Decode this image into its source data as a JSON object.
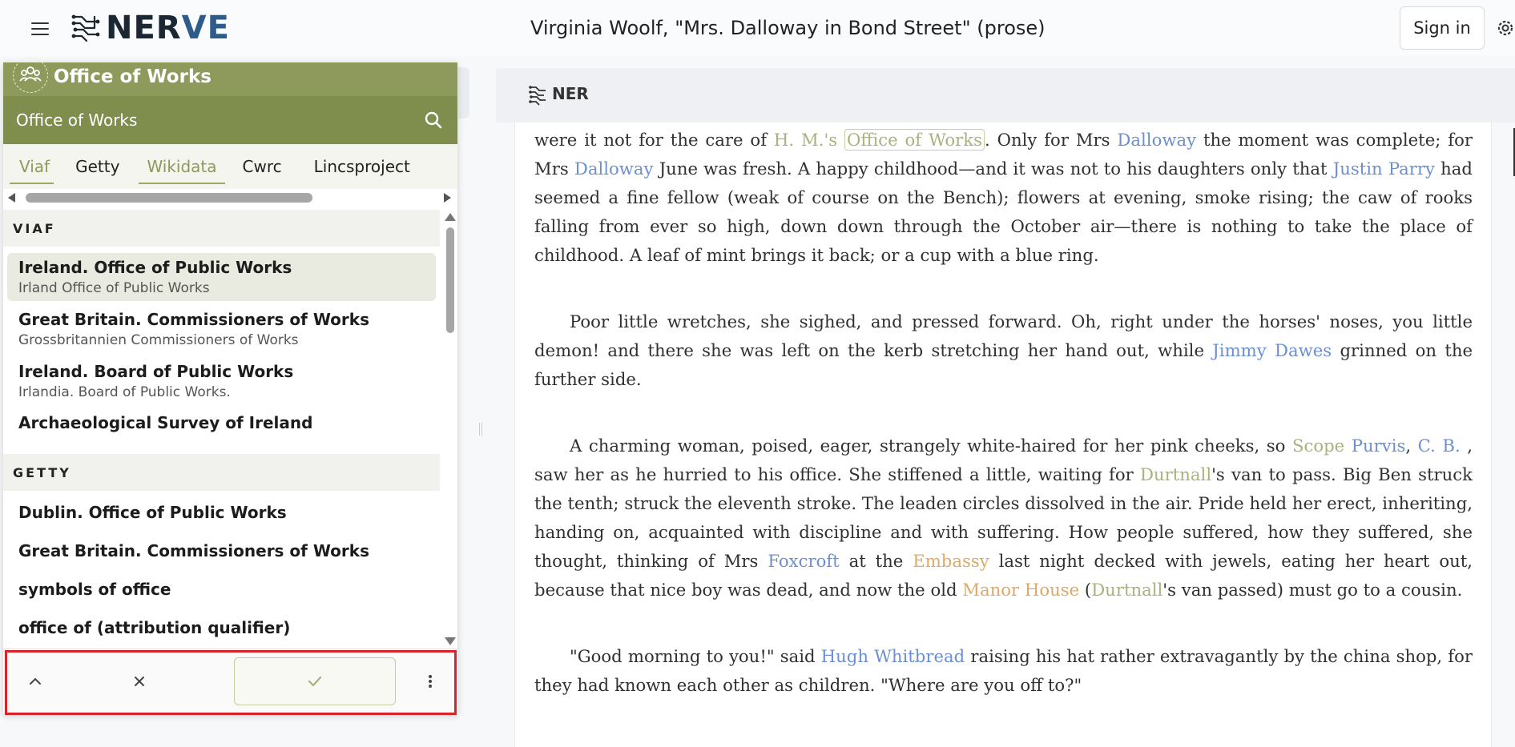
{
  "app": {
    "logo_text_a": "NER",
    "logo_text_b": "VE",
    "doc_title": "Virginia Woolf, \"Mrs. Dalloway in Bond Street\" (prose)",
    "sign_in_label": "Sign in",
    "icons": {
      "menu": "hamburger-icon",
      "settings": "gear-icon",
      "logo": "circuit-logo-icon"
    }
  },
  "panel": {
    "header_title": "Office of Works",
    "header_icon": "people-group-icon",
    "search": {
      "value": "Office of Works",
      "placeholder": "Search",
      "icon": "search-icon"
    },
    "tabs": [
      {
        "label": "Viaf",
        "active": true
      },
      {
        "label": "Getty",
        "active": false
      },
      {
        "label": "Wikidata",
        "active": true
      },
      {
        "label": "Cwrc",
        "active": false
      },
      {
        "label": "Lincsproject",
        "active": false
      }
    ],
    "sections": [
      {
        "heading": "VIAF",
        "items": [
          {
            "title": "Ireland. Office of Public Works",
            "subtitle": "Irland Office of Public Works",
            "selected": true
          },
          {
            "title": "Great Britain. Commissioners of Works",
            "subtitle": "Grossbritannien Commissioners of Works",
            "selected": false
          },
          {
            "title": "Ireland. Board of Public Works",
            "subtitle": "Irlandia. Board of Public Works.",
            "selected": false
          },
          {
            "title": "Archaeological Survey of Ireland",
            "subtitle": "",
            "selected": false
          }
        ]
      },
      {
        "heading": "GETTY",
        "items": [
          {
            "title": "Dublin. Office of Public Works",
            "subtitle": ""
          },
          {
            "title": "Great Britain. Commissioners of Works",
            "subtitle": ""
          },
          {
            "title": "symbols of office",
            "subtitle": ""
          },
          {
            "title": "office of (attribution qualifier)",
            "subtitle": ""
          }
        ]
      }
    ],
    "actions": {
      "up": "⌃",
      "close": "×",
      "confirm": "✓",
      "more": "⋮"
    }
  },
  "ner_bar": {
    "label": "NER",
    "icon": "ner-circuit-icon"
  },
  "colors": {
    "person": "#6b8fcf",
    "organization": "#a9b27a",
    "place": "#e0a865",
    "panel_header": "#8d9a5c",
    "highlight": "#d9232b"
  },
  "document": {
    "p1": [
      "were it not for the care of ",
      {
        "t": "H. M.'s",
        "c": "org"
      },
      " ",
      {
        "t": "Office of Works",
        "c": "sel"
      },
      ". Only for Mrs ",
      {
        "t": "Dalloway",
        "c": "person"
      },
      " the moment was complete; for Mrs ",
      {
        "t": "Dalloway",
        "c": "person"
      },
      " June was fresh. A happy childhood—and it was not to his daughters only that ",
      {
        "t": "Justin Parry",
        "c": "person"
      },
      " had seemed a fine fellow (weak of course on the Bench); flowers at evening, smoke rising; the caw of rooks falling from ever so high, down down through the October air—there is nothing to take the place of childhood. A leaf of mint brings it back; or a cup with a blue ring."
    ],
    "p2": [
      "Poor little wretches, she sighed, and pressed forward. Oh, right under the horses' noses, you little demon! and there she was left on the kerb stretching her hand out, while ",
      {
        "t": "Jimmy Dawes",
        "c": "person"
      },
      " grinned on the further side."
    ],
    "p3": [
      "A charming woman, poised, eager, strangely white-haired for her pink cheeks, so ",
      {
        "t": "Scope",
        "c": "org"
      },
      " ",
      {
        "t": "Purvis",
        "c": "person"
      },
      ", ",
      {
        "t": "C. B.",
        "c": "person"
      },
      " , saw her as he hurried to his office. She stiffened a little, waiting for ",
      {
        "t": "Durtnall",
        "c": "org"
      },
      "'s van to pass. Big Ben struck the tenth; struck the eleventh stroke. The leaden circles dissolved in the air. Pride held her erect, inheriting, handing on, acquainted with discipline and with suffering. How people suffered, how they suffered, she thought, thinking of Mrs ",
      {
        "t": "Foxcroft",
        "c": "person"
      },
      " at the ",
      {
        "t": "Embassy",
        "c": "place"
      },
      " last night decked with jewels, eating her heart out, because that nice boy was dead, and now the old ",
      {
        "t": "Manor House",
        "c": "place"
      },
      " (",
      {
        "t": "Durtnall",
        "c": "org"
      },
      "'s van passed) must go to a cousin."
    ],
    "p4": [
      "\"Good morning to you!\" said ",
      {
        "t": "Hugh Whitbread",
        "c": "person"
      },
      " raising his hat rather extravagantly by the china shop, for they had known each other as children. \"Where are you off to?\""
    ]
  }
}
